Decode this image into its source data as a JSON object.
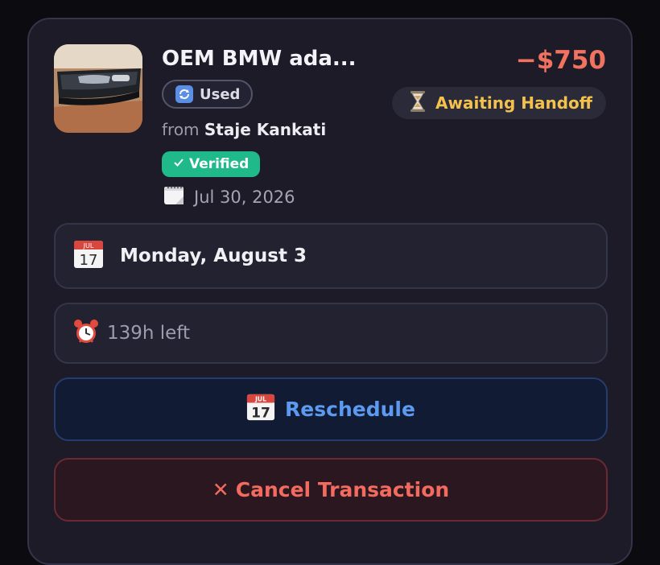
{
  "listing": {
    "title": "OEM BMW ada...",
    "price": "−$750",
    "condition": "Used",
    "condition_icon": "repeat-icon",
    "from_prefix": "from",
    "seller": "Staje Kankati",
    "verified_label": "Verified",
    "date": "Jul 30, 2026",
    "status": "Awaiting Handoff",
    "status_icon": "hourglass-icon"
  },
  "schedule": {
    "meetup_date": "Monday, August 3",
    "calendar_icon_month": "JUL",
    "calendar_icon_day": "17",
    "time_left": "139h left"
  },
  "actions": {
    "reschedule_label": "Reschedule",
    "cancel_label": "Cancel Transaction",
    "cancel_icon_glyph": "✕"
  },
  "colors": {
    "price": "#f27260",
    "status": "#f3c24d",
    "verified": "#1fb98a",
    "reschedule": "#5b9af0",
    "cancel": "#f36a5f"
  }
}
